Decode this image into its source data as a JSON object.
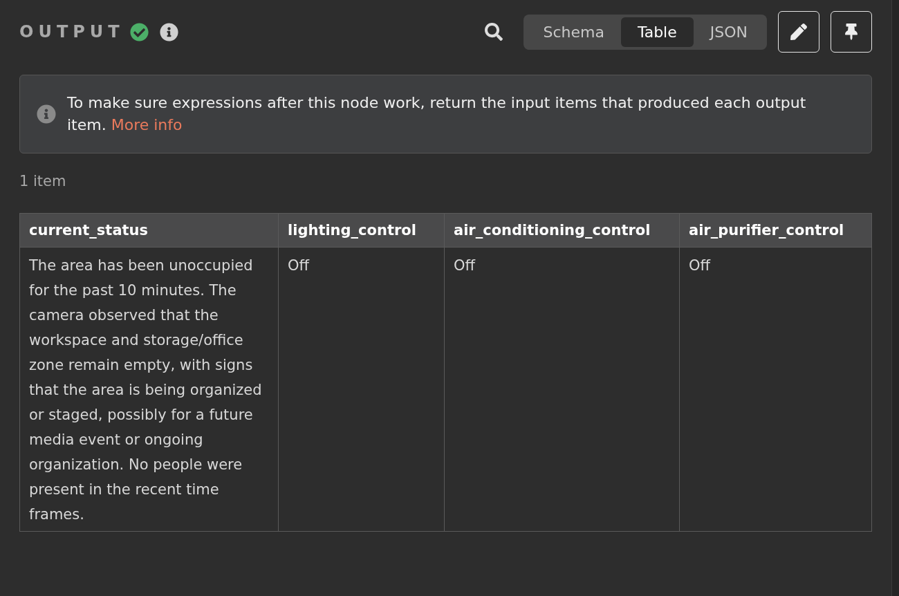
{
  "header": {
    "title": "OUTPUT"
  },
  "view_tabs": [
    {
      "label": "Schema",
      "selected": false
    },
    {
      "label": "Table",
      "selected": true
    },
    {
      "label": "JSON",
      "selected": false
    }
  ],
  "callout": {
    "text": "To make sure expressions after this node work, return the input items that produced each output item.",
    "link": "More info"
  },
  "item_count": "1 item",
  "table": {
    "columns": [
      "current_status",
      "lighting_control",
      "air_conditioning_control",
      "air_purifier_control"
    ],
    "rows": [
      [
        "The area has been unoccupied for the past 10 minutes. The camera observed that the workspace and storage/office zone remain empty, with signs that the area is being organized or staged, possibly for a future media event or ongoing organization. No people were present in the recent time frames.",
        "Off",
        "Off",
        "Off"
      ]
    ]
  }
}
